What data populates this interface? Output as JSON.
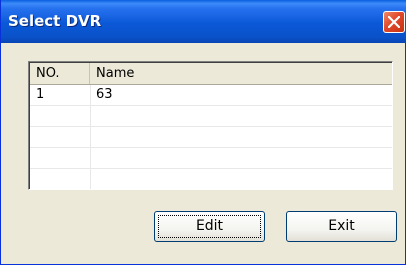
{
  "window": {
    "title": "Select DVR"
  },
  "list": {
    "columns": [
      "NO.",
      "Name"
    ],
    "rows": [
      {
        "no": "1",
        "name": "63"
      }
    ]
  },
  "buttons": {
    "edit_label": "Edit",
    "exit_label": "Exit"
  },
  "icons": {
    "close": "close-icon"
  }
}
